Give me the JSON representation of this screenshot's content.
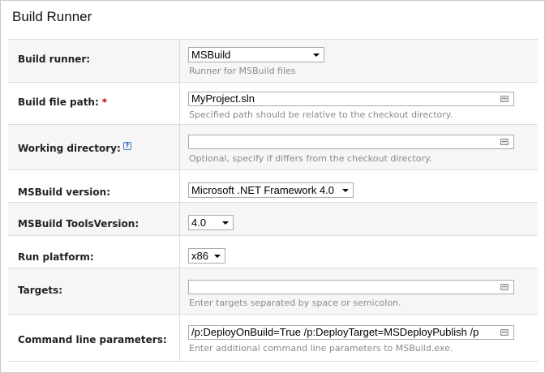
{
  "title": "Build Runner",
  "fields": {
    "build_runner": {
      "label": "Build runner:",
      "value": "MSBuild",
      "note": "Runner for MSBuild files"
    },
    "build_file_path": {
      "label": "Build file path:",
      "required_mark": "*",
      "value": "MyProject.sln",
      "note": "Specified path should be relative to the checkout directory."
    },
    "working_directory": {
      "label": "Working directory:",
      "help_icon": "?",
      "value": "",
      "note": "Optional, specify if differs from the checkout directory."
    },
    "msbuild_version": {
      "label": "MSBuild version:",
      "value": "Microsoft .NET Framework 4.0"
    },
    "msbuild_toolsversion": {
      "label": "MSBuild ToolsVersion:",
      "value": "4.0"
    },
    "run_platform": {
      "label": "Run platform:",
      "value": "x86"
    },
    "targets": {
      "label": "Targets:",
      "value": "",
      "note": "Enter targets separated by space or semicolon."
    },
    "command_line_parameters": {
      "label": "Command line parameters:",
      "value": "/p:DeployOnBuild=True /p:DeployTarget=MSDeployPublish /p",
      "note": "Enter additional command line parameters to MSBuild.exe."
    }
  },
  "icons": {
    "edit": "text-editor-icon",
    "dropdown": "chevron-down-icon",
    "help": "help-icon"
  }
}
